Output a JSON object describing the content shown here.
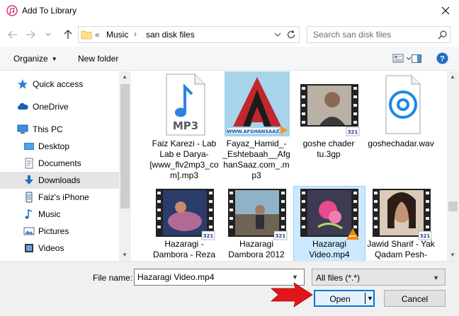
{
  "window": {
    "title": "Add To Library",
    "app_icon": "itunes-icon",
    "close_icon": "close-icon"
  },
  "address": {
    "prefix": "«",
    "crumbs": [
      "Music",
      "san disk files"
    ],
    "separator": "›"
  },
  "search": {
    "placeholder": "Search san disk files"
  },
  "toolbar": {
    "organize_label": "Organize",
    "new_folder_label": "New folder"
  },
  "nav": {
    "items": [
      {
        "label": "Quick access",
        "icon": "star-icon"
      },
      {
        "label": "OneDrive",
        "icon": "cloud-icon"
      },
      {
        "label": "This PC",
        "icon": "computer-icon"
      },
      {
        "label": "Desktop",
        "icon": "desktop-icon"
      },
      {
        "label": "Documents",
        "icon": "documents-icon"
      },
      {
        "label": "Downloads",
        "icon": "download-icon"
      },
      {
        "label": "Faiz's iPhone",
        "icon": "phone-icon"
      },
      {
        "label": "Music",
        "icon": "music-icon"
      },
      {
        "label": "Pictures",
        "icon": "pictures-icon"
      },
      {
        "label": "Videos",
        "icon": "videos-icon"
      }
    ],
    "selected": "Downloads"
  },
  "files": [
    {
      "name": "Faiz Karezi - Lab Lab e Darya-[www_flv2mp3_com].mp3",
      "kind": "mp3"
    },
    {
      "name": "Fayaz_Hamid_-_Eshtebaah__AfghanSaaz.com_.mp3",
      "kind": "image-afghansaaz",
      "watermark": "WWW.AFGHANSAAZ"
    },
    {
      "name": "goshe chader tu.3gp",
      "kind": "video"
    },
    {
      "name": "goshechadar.wav",
      "kind": "wav"
    },
    {
      "name": "Hazaragi - Dambora - Reza",
      "kind": "video"
    },
    {
      "name": "Hazaragi Dambora 2012",
      "kind": "video"
    },
    {
      "name": "Hazaragi Video.mp4",
      "kind": "video-vlc",
      "selected": true
    },
    {
      "name": "Jawid Sharif - Yak Qadam Pesh-",
      "kind": "video"
    }
  ],
  "footer": {
    "file_name_label": "File name:",
    "file_name_value": "Hazaragi Video.mp4",
    "file_type": "All files (*.*)",
    "open_label": "Open",
    "cancel_label": "Cancel"
  },
  "colors": {
    "accent": "#0078d7",
    "selected_bg": "#cce8ff",
    "annotation_arrow": "#e0161b"
  }
}
